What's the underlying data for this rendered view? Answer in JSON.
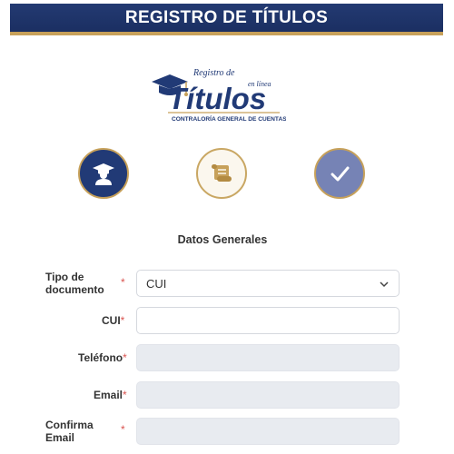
{
  "header": {
    "title": "REGISTRO DE TÍTULOS"
  },
  "logo": {
    "top_text": "Registro de",
    "main_text": "Títulos",
    "tagline": "en línea",
    "org": "CONTRALORÍA GENERAL DE CUENTAS"
  },
  "steps": [
    {
      "icon": "graduate-icon",
      "state": "active"
    },
    {
      "icon": "diploma-scroll-icon",
      "state": "pending"
    },
    {
      "icon": "check-icon",
      "state": "complete"
    }
  ],
  "form": {
    "section_title": "Datos Generales",
    "tipo_documento": {
      "label_line1": "Tipo de",
      "label_line2": "documento",
      "required_mark": "*",
      "value": "CUI"
    },
    "cui": {
      "label": "CUI",
      "required_mark": "*",
      "value": ""
    },
    "telefono": {
      "label": "Teléfono",
      "required_mark": "*",
      "value": ""
    },
    "email": {
      "label": "Email",
      "required_mark": "*",
      "value": ""
    },
    "confirma_email": {
      "label_line1": "Confirma",
      "label_line2": "Email",
      "required_mark": "*",
      "value": ""
    }
  },
  "colors": {
    "navy": "#213a76",
    "gold": "#c7a15a",
    "lavender": "#7683b5",
    "required": "#d9534f",
    "disabled_field": "#e8ebf0"
  }
}
